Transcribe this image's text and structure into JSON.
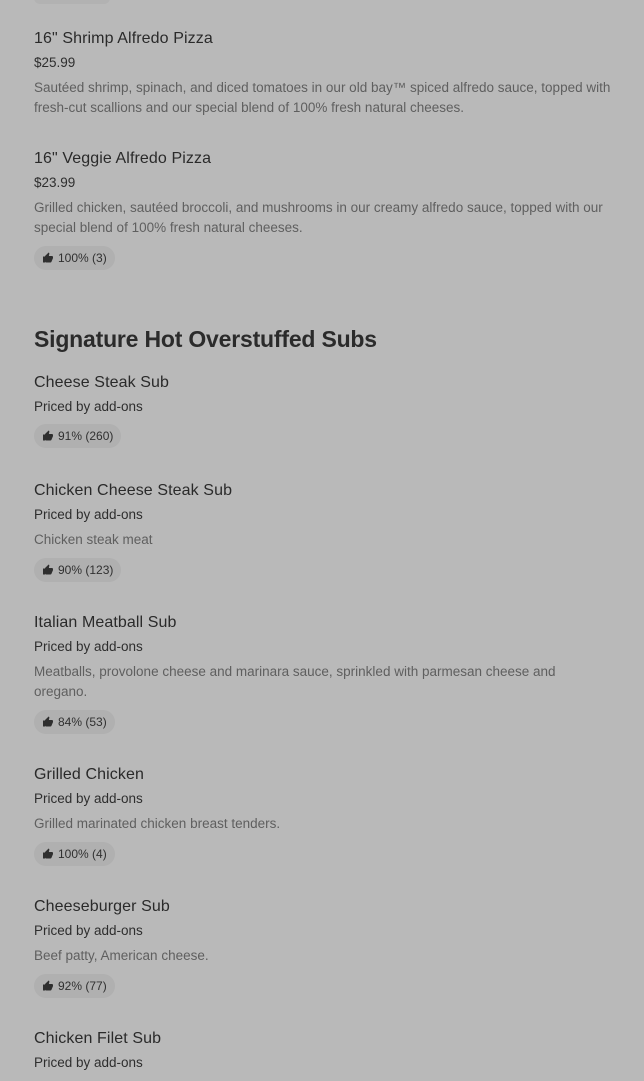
{
  "items_top": [
    {
      "name": "16\" Shrimp Alfredo Pizza",
      "price": "$25.99",
      "description": "Sautéed shrimp, spinach, and diced tomatoes in our old bay™ spiced alfredo sauce, topped with fresh-cut scallions and our special blend of 100% fresh natural cheeses."
    },
    {
      "name": "16\" Veggie Alfredo Pizza",
      "price": "$23.99",
      "description": "Grilled chicken, sautéed broccoli, and mushrooms in our creamy alfredo sauce, topped with our special blend of 100% fresh natural cheeses.",
      "rating": "100% (3)"
    }
  ],
  "section": {
    "title": "Signature Hot Overstuffed Subs",
    "items": [
      {
        "name": "Cheese Steak Sub",
        "price": "Priced by add-ons",
        "rating": "91% (260)"
      },
      {
        "name": "Chicken Cheese Steak Sub",
        "price": "Priced by add-ons",
        "description": "Chicken steak meat",
        "rating": "90% (123)"
      },
      {
        "name": "Italian Meatball Sub",
        "price": "Priced by add-ons",
        "description": "Meatballs, provolone cheese and marinara sauce, sprinkled with parmesan cheese and oregano.",
        "rating": "84% (53)"
      },
      {
        "name": "Grilled Chicken",
        "price": "Priced by add-ons",
        "description": "Grilled marinated chicken breast tenders.",
        "rating": "100% (4)"
      },
      {
        "name": "Cheeseburger Sub",
        "price": "Priced by add-ons",
        "description": "Beef patty, American cheese.",
        "rating": "92% (77)"
      },
      {
        "name": "Chicken Filet Sub",
        "price": "Priced by add-ons"
      }
    ]
  },
  "icons": {
    "rating": "thumbs-up-icon"
  },
  "colors": {
    "overlay_background": "#b9b9b9",
    "chip_background": "#b0b0b0"
  }
}
